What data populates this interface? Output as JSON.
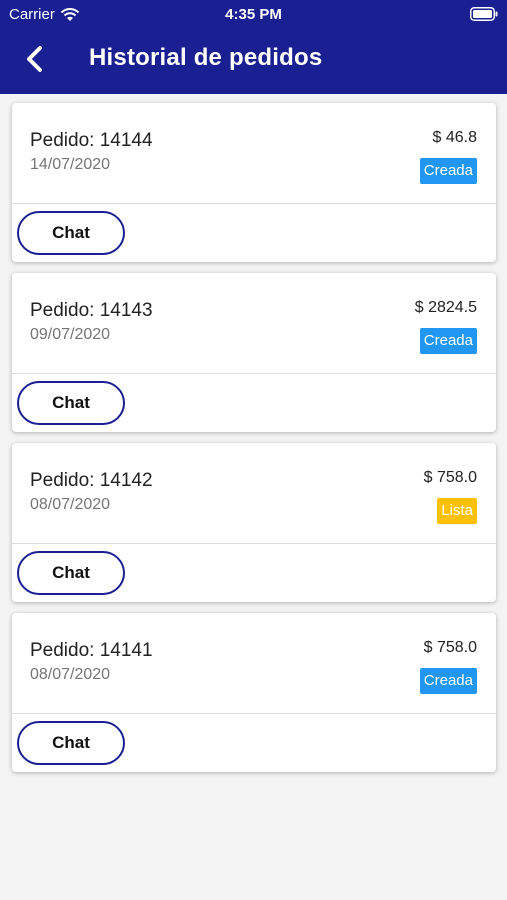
{
  "status_bar": {
    "carrier": "Carrier",
    "time": "4:35 PM"
  },
  "header": {
    "title": "Historial de pedidos"
  },
  "colors": {
    "primary": "#1a1f91",
    "badge_creada": "#2196f3",
    "badge_lista": "#ffc107"
  },
  "orders": [
    {
      "label": "Pedido: 14144",
      "date": "14/07/2020",
      "price": "$ 46.8",
      "status": "Creada",
      "chat_label": "Chat"
    },
    {
      "label": "Pedido: 14143",
      "date": "09/07/2020",
      "price": "$ 2824.5",
      "status": "Creada",
      "chat_label": "Chat"
    },
    {
      "label": "Pedido: 14142",
      "date": "08/07/2020",
      "price": "$ 758.0",
      "status": "Lista",
      "chat_label": "Chat"
    },
    {
      "label": "Pedido: 14141",
      "date": "08/07/2020",
      "price": "$ 758.0",
      "status": "Creada",
      "chat_label": "Chat"
    }
  ]
}
